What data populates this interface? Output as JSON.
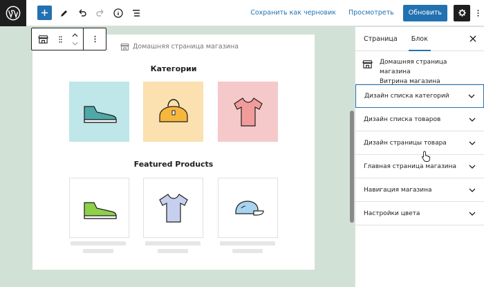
{
  "topbar": {
    "save_draft": "Сохранить как черновик",
    "preview": "Просмотреть",
    "update": "Обновить",
    "icons": [
      "wordpress-logo-icon",
      "plus-icon",
      "pencil-icon",
      "undo-icon",
      "redo-icon",
      "info-icon",
      "list-view-icon",
      "gear-icon",
      "kebab-icon"
    ]
  },
  "canvas": {
    "block_label": "Домашняя страница магазина",
    "categories_title": "Категории",
    "featured_title": "Featured Products",
    "category_tiles": [
      {
        "icon": "sneaker-icon",
        "bg": "#bfe6e8"
      },
      {
        "icon": "bag-icon",
        "bg": "#fbe0b0"
      },
      {
        "icon": "tshirt-icon",
        "bg": "#f5c9c9"
      }
    ],
    "product_tiles": [
      {
        "icon": "sneaker-icon"
      },
      {
        "icon": "tshirt-icon"
      },
      {
        "icon": "cap-icon"
      }
    ]
  },
  "sidebar": {
    "tabs": [
      "Страница",
      "Блок"
    ],
    "active_tab": "Блок",
    "block_name": "Домашняя страница магазина",
    "block_desc": "Витрина магазина",
    "panels": [
      "Дизайн списка категорий",
      "Дизайн списка товаров",
      "Дизайн страницы товара",
      "Главная страница магазина",
      "Навигация магазина",
      "Настройки цвета"
    ]
  },
  "colors": {
    "accent": "#2271b1",
    "canvas_bg": "#d2e1d6",
    "dark": "#1e1e1e"
  }
}
